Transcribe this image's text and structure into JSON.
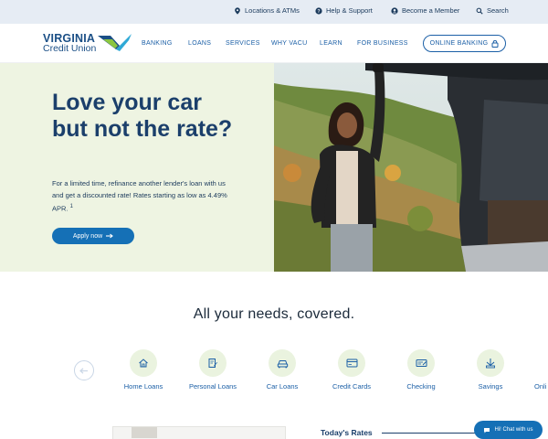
{
  "utility": {
    "locations": "Locations & ATMs",
    "help": "Help & Support",
    "member": "Become a Member",
    "search": "Search"
  },
  "logo": {
    "line1": "VIRGINIA",
    "line2": "Credit Union"
  },
  "nav": [
    "BANKING",
    "LOANS",
    "SERVICES",
    "WHY VACU",
    "LEARN",
    "FOR BUSINESS"
  ],
  "online_banking": "ONLINE BANKING",
  "hero": {
    "title": "Love your car but not the rate?",
    "body": "For a limited time, refinance another lender's loan with us and get a discounted rate! Rates starting as low as 4.49% APR.",
    "footnote": "1",
    "cta": "Apply now"
  },
  "needs": {
    "title": "All your needs, covered.",
    "products": [
      {
        "label": "Home Loans",
        "icon": "house-icon"
      },
      {
        "label": "Personal Loans",
        "icon": "document-pen-icon"
      },
      {
        "label": "Car Loans",
        "icon": "car-icon"
      },
      {
        "label": "Credit Cards",
        "icon": "credit-card-icon"
      },
      {
        "label": "Checking",
        "icon": "checkbook-icon"
      },
      {
        "label": "Savings",
        "icon": "savings-icon"
      },
      {
        "label": "Onli",
        "icon": "online-icon"
      }
    ]
  },
  "rates": {
    "title": "Today's Rates"
  },
  "chat": {
    "label": "Hi! Chat with us"
  },
  "colors": {
    "brand_blue": "#1b5fa6",
    "cta_blue": "#1570b6",
    "hero_bg": "#eef4e2",
    "utility_bg": "#e6ecf4"
  }
}
